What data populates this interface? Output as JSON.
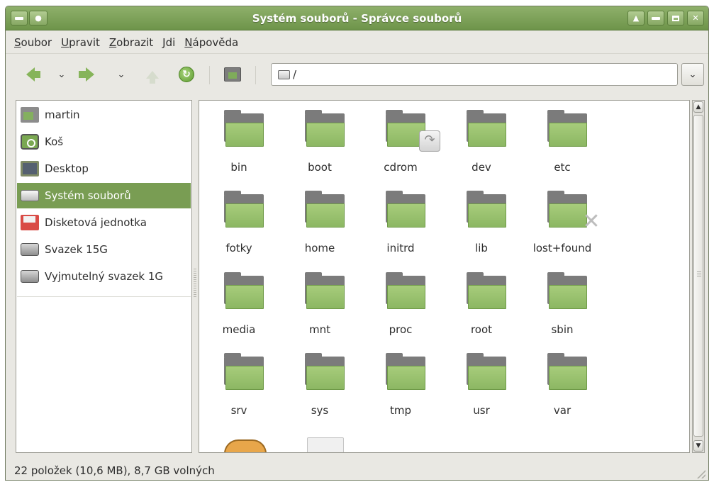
{
  "window": {
    "title": "Systém souborů - Správce souborů",
    "buttons": [
      "window-menu",
      "stick",
      "up",
      "minimize",
      "maximize",
      "close"
    ]
  },
  "menubar": {
    "items": [
      {
        "mnemonic": "S",
        "rest": "oubor"
      },
      {
        "mnemonic": "U",
        "rest": "pravit"
      },
      {
        "mnemonic": "Z",
        "rest": "obrazit"
      },
      {
        "mnemonic": "J",
        "rest": "di"
      },
      {
        "mnemonic": "N",
        "rest": "ápověda"
      }
    ]
  },
  "toolbar": {
    "location_value": "/",
    "icons": [
      "back-arrow-icon",
      "history-dropdown-icon",
      "forward-arrow-icon",
      "history-dropdown-icon",
      "up-arrow-icon",
      "reload-icon",
      "home-folder-icon",
      "drive-icon",
      "dropdown-icon"
    ]
  },
  "sidebar": {
    "items": [
      {
        "label": "martin",
        "icon": "home-folder-icon",
        "selected": false
      },
      {
        "label": "Koš",
        "icon": "trash-icon",
        "selected": false
      },
      {
        "label": "Desktop",
        "icon": "desktop-icon",
        "selected": false
      },
      {
        "label": "Systém souborů",
        "icon": "filesystem-drive-icon",
        "selected": true
      },
      {
        "label": "Disketová jednotka",
        "icon": "floppy-icon",
        "selected": false
      },
      {
        "label": "Svazek 15G",
        "icon": "hard-drive-icon",
        "selected": false
      },
      {
        "label": "Vyjmutelný svazek 1G",
        "icon": "removable-drive-icon",
        "selected": false
      }
    ]
  },
  "files": [
    {
      "name": "bin",
      "emblem": ""
    },
    {
      "name": "boot",
      "emblem": ""
    },
    {
      "name": "cdrom",
      "emblem": "symlink"
    },
    {
      "name": "dev",
      "emblem": ""
    },
    {
      "name": "etc",
      "emblem": ""
    },
    {
      "name": "fotky",
      "emblem": ""
    },
    {
      "name": "home",
      "emblem": ""
    },
    {
      "name": "initrd",
      "emblem": ""
    },
    {
      "name": "lib",
      "emblem": ""
    },
    {
      "name": "lost+found",
      "emblem": "unreadable"
    },
    {
      "name": "media",
      "emblem": ""
    },
    {
      "name": "mnt",
      "emblem": ""
    },
    {
      "name": "proc",
      "emblem": ""
    },
    {
      "name": "root",
      "emblem": ""
    },
    {
      "name": "sbin",
      "emblem": ""
    },
    {
      "name": "srv",
      "emblem": ""
    },
    {
      "name": "sys",
      "emblem": ""
    },
    {
      "name": "tmp",
      "emblem": ""
    },
    {
      "name": "usr",
      "emblem": ""
    },
    {
      "name": "var",
      "emblem": ""
    }
  ],
  "status": {
    "text": "22 položek (10,6 MB), 8,7 GB volných"
  },
  "colors": {
    "titlebar": "#7ea15a",
    "selection": "#799d53",
    "folder_green": "#9cc46f",
    "folder_gray": "#7b7b7b"
  }
}
